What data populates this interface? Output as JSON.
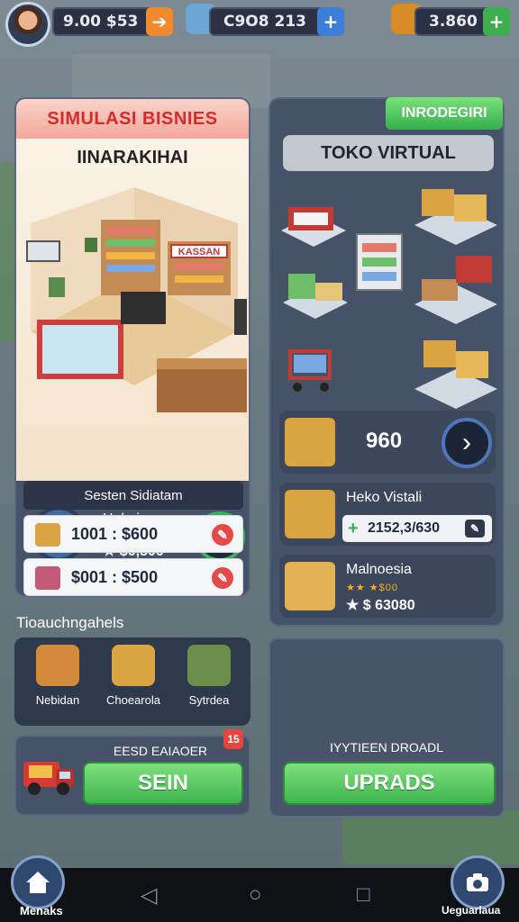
{
  "topbar": {
    "coins": "9.00 $53",
    "gems": "C9O8 213",
    "chest": "3.860"
  },
  "left_card": {
    "header": "SIMULASI BISNIES",
    "subtitle": "IINARAKIHAI",
    "store_sign": "KASSAN",
    "info": {
      "name": "Hekajo",
      "stars": "★★★★★",
      "value": "★ $0,800"
    },
    "system": {
      "title": "Sesten Sidiatam",
      "rows": [
        {
          "text": "1001 : $600"
        },
        {
          "text": "$001 : $500"
        }
      ]
    }
  },
  "section_label": "Tioauchngahels",
  "shop_items": [
    {
      "label": "Nebidan"
    },
    {
      "label": "Choearola"
    },
    {
      "label": "Sytrdea"
    }
  ],
  "sell": {
    "label": "EESD EAIAOER",
    "badge": "15",
    "button": "SEIN"
  },
  "right_card": {
    "tag": "INRODEGIRI",
    "title": "TOKO VIRTUAL",
    "price": "960",
    "product1": {
      "name": "Heko Vistali",
      "value": "2152,3/630"
    },
    "product2": {
      "name": "Malnoesia",
      "stars": "★★ ★$00",
      "value": "★ $ 63080"
    }
  },
  "upgrade": {
    "label": "IYYTIEEN DROADL",
    "button": "UPRADS"
  },
  "nav": {
    "home_label": "Menaks",
    "camera_label": "Ueguarlaua"
  },
  "colors": {
    "accent_green": "#3eb54f",
    "header_red": "#d42c2c",
    "panel": "#465268"
  }
}
